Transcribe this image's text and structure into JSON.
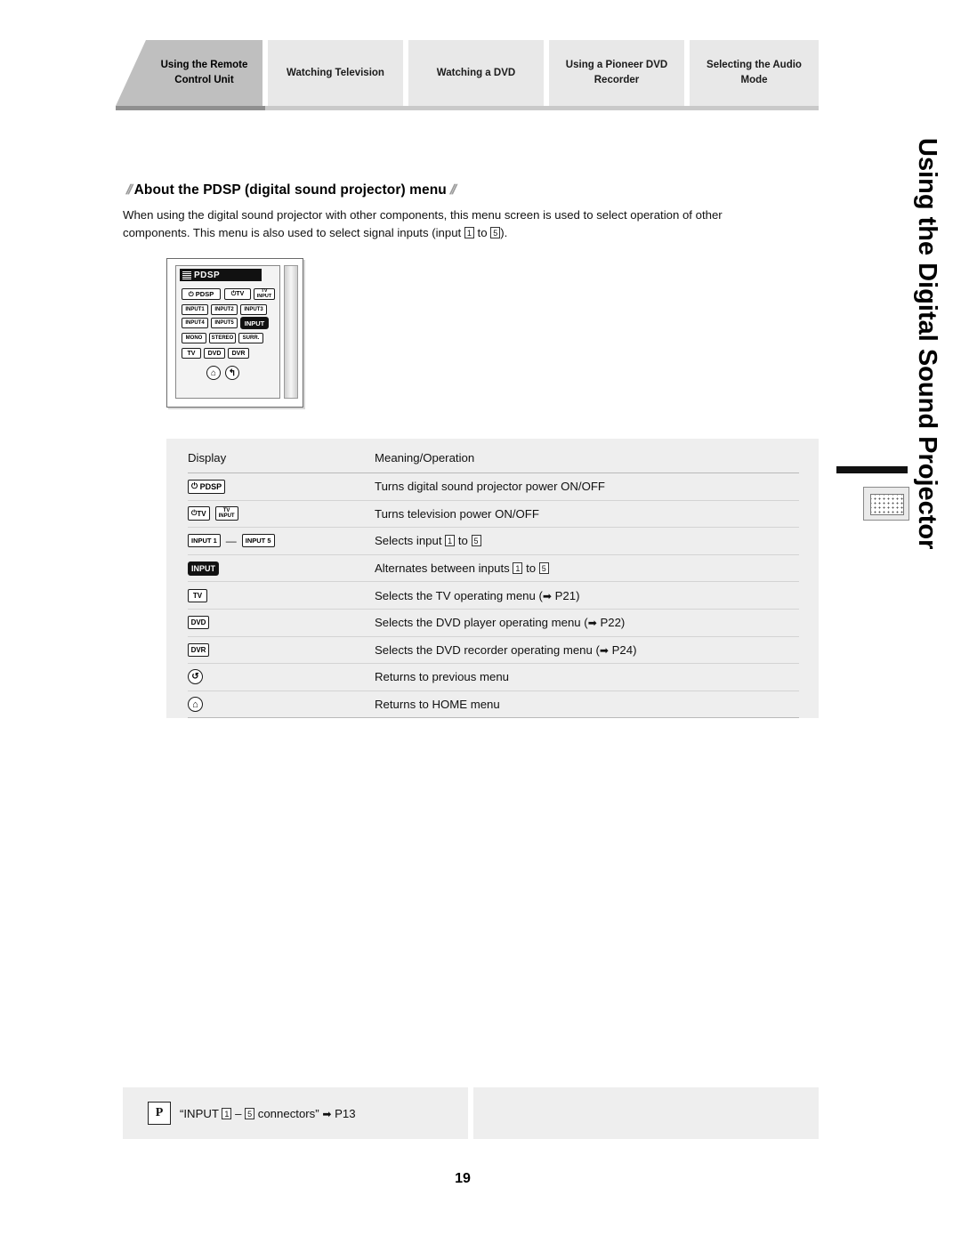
{
  "tabs": [
    {
      "label": "Using the Remote Control Unit",
      "active": true
    },
    {
      "label": "Watching Television",
      "active": false
    },
    {
      "label": "Watching a DVD",
      "active": false
    },
    {
      "label": "Using a Pioneer DVD Recorder",
      "active": false
    },
    {
      "label": "Selecting the Audio Mode",
      "active": false
    }
  ],
  "heading": {
    "text": "About the PDSP (digital sound projector) menu"
  },
  "intro": {
    "line1": "When using the digital sound projector with other components, this menu screen is used to select operation of other",
    "line2_a": "components. This menu is also used to select signal inputs (input ",
    "key1": "1",
    "line2_b": " to ",
    "key5": "5",
    "line2_c": ")."
  },
  "remote": {
    "screen_title": "PDSP",
    "buttons": [
      {
        "label": "PDSP",
        "prefix": "⏻"
      },
      {
        "label": "TV",
        "prefix": "⏻"
      },
      {
        "label": "TV",
        "sub": "INPUT"
      },
      {
        "label": "INPUT1"
      },
      {
        "label": "INPUT2"
      },
      {
        "label": "INPUT3"
      },
      {
        "label": "INPUT4"
      },
      {
        "label": "INPUT5"
      },
      {
        "label": "INPUT"
      },
      {
        "label": "MONO"
      },
      {
        "label": "STEREO"
      },
      {
        "label": "SURR."
      },
      {
        "label": "TV"
      },
      {
        "label": "DVD"
      },
      {
        "label": "DVR"
      },
      {
        "label": "home"
      },
      {
        "label": "return"
      }
    ]
  },
  "table": {
    "headers": {
      "display": "Display",
      "meaning": "Meaning/Operation"
    },
    "rows": [
      {
        "icon_type": "power-pdsp",
        "icon_label": "PDSP",
        "meaning": "Turns digital sound projector power ON/OFF"
      },
      {
        "icon_type": "power-tv",
        "icon_label": "TV",
        "icon_label2": "TV",
        "icon_sub2": "INPUT",
        "meaning": "Turns television power ON/OFF"
      },
      {
        "icon_type": "input-range",
        "icon_label": "INPUT 1",
        "icon_label2": "INPUT 5",
        "meaning_a": "Selects input ",
        "key1": "1",
        "meaning_b": " to ",
        "key5": "5"
      },
      {
        "icon_type": "input",
        "icon_label": "INPUT",
        "meaning_a": "Alternates between inputs ",
        "key1": "1",
        "meaning_b": " to ",
        "key5": "5"
      },
      {
        "icon_type": "tv",
        "icon_label": "TV",
        "meaning": "Selects the TV operating menu (",
        "page_ref": "P21"
      },
      {
        "icon_type": "dvd",
        "icon_label": "DVD",
        "meaning": "Selects the DVD player operating menu (",
        "page_ref": "P22"
      },
      {
        "icon_type": "dvr",
        "icon_label": "DVR",
        "meaning": "Selects the  DVD recorder operating menu (",
        "page_ref": "P24"
      },
      {
        "icon_type": "return",
        "icon_label": "↺",
        "meaning": "Returns to previous menu"
      },
      {
        "icon_type": "home",
        "icon_label": "⌂",
        "meaning": "Returns to HOME menu"
      }
    ]
  },
  "side_title": "Using the Digital Sound Projector",
  "footnote": {
    "pmark": "P",
    "text_a": "“INPUT ",
    "key1": "1",
    "text_b": " – ",
    "key5": "5",
    "text_c": " connectors” ",
    "arrow": "➡",
    "page_ref": "P13"
  },
  "page_number": "19"
}
